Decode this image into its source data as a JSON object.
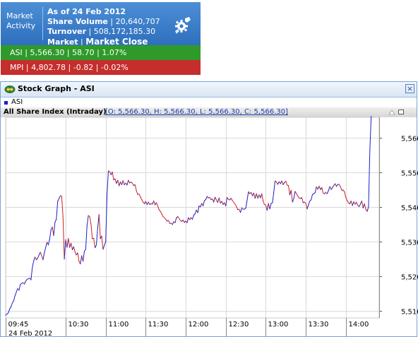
{
  "market": {
    "label": "Market Activity",
    "as_of": "As of 24 Feb 2012",
    "share_volume_label": "Share Volume",
    "share_volume": "20,640,707",
    "turnover_label": "Turnover",
    "turnover": "508,172,185.30",
    "market_label": "Market",
    "market_status": "Market Close",
    "icon": "gear-settings-icon",
    "asi_text": "ASI | 5,566.30 | 58.70 | 1.07%",
    "mpi_text": "MPI | 4,802.78 | -0.82 | -0.02%",
    "asi_color": "#2f9a2a",
    "mpi_color": "#c62d2d"
  },
  "window": {
    "title": "Stock Graph - ASI",
    "close_label": "×",
    "legend_label": "ASI",
    "legend_color": "#1e1ec8",
    "index_name": "All Share Index (Intraday)",
    "ohlc": "[O: 5,566.30,  H: 5,566.30,  L: 5,566.30,  C: 5,566.30]"
  },
  "chart_data": {
    "type": "line",
    "title": "All Share Index (Intraday)",
    "xlabel": "",
    "ylabel": "",
    "date_label": "24 Feb 2012",
    "x_ticks": [
      "09:45",
      "10:30",
      "11:00",
      "11:30",
      "12:00",
      "12:30",
      "13:00",
      "13:30",
      "14:00"
    ],
    "y_ticks": [
      "5,510",
      "5,520",
      "5,530",
      "5,540",
      "5,550",
      "5,560"
    ],
    "x_range_minutes": [
      585,
      865
    ],
    "ylim": [
      5508,
      5566
    ],
    "grid": true,
    "up_color": "#1e1ec8",
    "down_color": "#d21e1e",
    "series": [
      {
        "name": "ASI",
        "points": [
          [
            585,
            5508.8
          ],
          [
            587,
            5509.5
          ],
          [
            588,
            5510.6
          ],
          [
            589,
            5511.2
          ],
          [
            590,
            5512.3
          ],
          [
            591,
            5512.9
          ],
          [
            592,
            5514.4
          ],
          [
            594,
            5516.5
          ],
          [
            595,
            5516.0
          ],
          [
            596,
            5517.7
          ],
          [
            598,
            5518.2
          ],
          [
            599,
            5517.8
          ],
          [
            600,
            5518.6
          ],
          [
            601,
            5519.1
          ],
          [
            603,
            5519.5
          ],
          [
            604,
            5519.0
          ],
          [
            605,
            5522.6
          ],
          [
            606,
            5524.5
          ],
          [
            607,
            5525.6
          ],
          [
            608,
            5524.8
          ],
          [
            609,
            5525.3
          ],
          [
            611,
            5527.0
          ],
          [
            612,
            5526.0
          ],
          [
            613,
            5524.8
          ],
          [
            614,
            5526.8
          ],
          [
            616,
            5529.9
          ],
          [
            617,
            5529.1
          ],
          [
            618,
            5530.8
          ],
          [
            619,
            5533.4
          ],
          [
            620,
            5534.3
          ],
          [
            621,
            5531.8
          ],
          [
            622,
            5535.7
          ],
          [
            623,
            5536.5
          ],
          [
            624,
            5541.7
          ],
          [
            626,
            5543.3
          ],
          [
            627,
            5543.2
          ],
          [
            628,
            5537.4
          ],
          [
            629,
            5525.0
          ],
          [
            630,
            5530.6
          ],
          [
            631,
            5528.4
          ],
          [
            632,
            5531.0
          ],
          [
            633,
            5528.4
          ],
          [
            634,
            5529.6
          ],
          [
            635,
            5527.7
          ],
          [
            636,
            5528.6
          ],
          [
            637,
            5527.1
          ],
          [
            638,
            5526.2
          ],
          [
            639,
            5526.8
          ],
          [
            640,
            5524.4
          ],
          [
            641,
            5523.6
          ],
          [
            642,
            5526.0
          ],
          [
            643,
            5524.4
          ],
          [
            644,
            5527.3
          ],
          [
            645,
            5527.8
          ],
          [
            646,
            5534.6
          ],
          [
            647,
            5537.6
          ],
          [
            648,
            5537.3
          ],
          [
            649,
            5535.1
          ],
          [
            650,
            5530.9
          ],
          [
            651,
            5531.0
          ],
          [
            652,
            5528.3
          ],
          [
            653,
            5529.1
          ],
          [
            654,
            5534.1
          ],
          [
            655,
            5537.9
          ],
          [
            656,
            5530.9
          ],
          [
            657,
            5531.7
          ],
          [
            658,
            5527.8
          ],
          [
            660,
            5530.1
          ],
          [
            661,
            5543.7
          ],
          [
            662,
            5550.5
          ],
          [
            663,
            5550.3
          ],
          [
            664,
            5549.4
          ],
          [
            665,
            5550.2
          ],
          [
            666,
            5547.9
          ],
          [
            667,
            5548.2
          ],
          [
            668,
            5546.9
          ],
          [
            669,
            5547.8
          ],
          [
            670,
            5546.2
          ],
          [
            671,
            5547.3
          ],
          [
            672,
            5546.5
          ],
          [
            673,
            5547.7
          ],
          [
            674,
            5546.5
          ],
          [
            675,
            5547.0
          ],
          [
            676,
            5546.4
          ],
          [
            677,
            5547.8
          ],
          [
            678,
            5547.0
          ],
          [
            679,
            5547.3
          ],
          [
            680,
            5546.9
          ],
          [
            681,
            5546.3
          ],
          [
            682,
            5546.5
          ],
          [
            683,
            5544.8
          ],
          [
            684,
            5543.7
          ],
          [
            685,
            5543.8
          ],
          [
            686,
            5543.0
          ],
          [
            687,
            5542.2
          ],
          [
            688,
            5541.5
          ],
          [
            689,
            5541.0
          ],
          [
            690,
            5541.7
          ],
          [
            691,
            5540.8
          ],
          [
            692,
            5541.5
          ],
          [
            693,
            5540.8
          ],
          [
            694,
            5541.0
          ],
          [
            695,
            5540.9
          ],
          [
            696,
            5541.8
          ],
          [
            697,
            5540.7
          ],
          [
            698,
            5541.3
          ],
          [
            699,
            5540.3
          ],
          [
            700,
            5539.3
          ],
          [
            701,
            5538.8
          ],
          [
            702,
            5538.1
          ],
          [
            703,
            5537.3
          ],
          [
            704,
            5537.0
          ],
          [
            705,
            5536.5
          ],
          [
            706,
            5536.0
          ],
          [
            707,
            5536.2
          ],
          [
            708,
            5535.3
          ],
          [
            709,
            5535.4
          ],
          [
            710,
            5535.0
          ],
          [
            711,
            5535.8
          ],
          [
            712,
            5535.5
          ],
          [
            713,
            5536.9
          ],
          [
            714,
            5537.3
          ],
          [
            715,
            5536.8
          ],
          [
            716,
            5536.1
          ],
          [
            717,
            5535.9
          ],
          [
            718,
            5536.3
          ],
          [
            719,
            5535.6
          ],
          [
            720,
            5536.0
          ],
          [
            721,
            5535.5
          ],
          [
            722,
            5537.0
          ],
          [
            723,
            5536.4
          ],
          [
            724,
            5537.0
          ],
          [
            725,
            5536.5
          ],
          [
            726,
            5537.7
          ],
          [
            727,
            5538.1
          ],
          [
            728,
            5539.2
          ],
          [
            729,
            5538.4
          ],
          [
            730,
            5540.4
          ],
          [
            731,
            5540.1
          ],
          [
            732,
            5541.1
          ],
          [
            733,
            5540.4
          ],
          [
            734,
            5541.9
          ],
          [
            735,
            5542.2
          ],
          [
            736,
            5543.1
          ],
          [
            737,
            5542.7
          ],
          [
            738,
            5542.8
          ],
          [
            739,
            5542.2
          ],
          [
            740,
            5542.4
          ],
          [
            741,
            5541.5
          ],
          [
            742,
            5542.9
          ],
          [
            743,
            5542.1
          ],
          [
            744,
            5541.4
          ],
          [
            745,
            5542.7
          ],
          [
            746,
            5541.2
          ],
          [
            747,
            5541.7
          ],
          [
            748,
            5540.8
          ],
          [
            749,
            5541.3
          ],
          [
            750,
            5540.4
          ],
          [
            751,
            5542.8
          ],
          [
            752,
            5542.3
          ],
          [
            753,
            5542.1
          ],
          [
            754,
            5542.6
          ],
          [
            755,
            5541.9
          ],
          [
            756,
            5541.4
          ],
          [
            757,
            5540.9
          ],
          [
            758,
            5540.2
          ],
          [
            759,
            5539.3
          ],
          [
            760,
            5539.4
          ],
          [
            761,
            5538.5
          ],
          [
            762,
            5539.8
          ],
          [
            763,
            5539.4
          ],
          [
            764,
            5539.5
          ],
          [
            765,
            5539.7
          ],
          [
            766,
            5542.1
          ],
          [
            767,
            5544.5
          ],
          [
            768,
            5543.9
          ],
          [
            769,
            5544.3
          ],
          [
            770,
            5543.3
          ],
          [
            771,
            5544.1
          ],
          [
            772,
            5542.6
          ],
          [
            773,
            5543.9
          ],
          [
            774,
            5542.6
          ],
          [
            775,
            5543.6
          ],
          [
            776,
            5542.7
          ],
          [
            777,
            5543.9
          ],
          [
            778,
            5541.8
          ],
          [
            779,
            5540.8
          ],
          [
            780,
            5540.6
          ],
          [
            781,
            5539.1
          ],
          [
            782,
            5541.1
          ],
          [
            783,
            5539.5
          ],
          [
            784,
            5541.1
          ],
          [
            785,
            5541.3
          ],
          [
            786,
            5544.3
          ],
          [
            787,
            5547.6
          ],
          [
            788,
            5547.3
          ],
          [
            789,
            5546.6
          ],
          [
            790,
            5547.4
          ],
          [
            791,
            5546.8
          ],
          [
            792,
            5547.6
          ],
          [
            793,
            5546.5
          ],
          [
            794,
            5547.2
          ],
          [
            795,
            5547.5
          ],
          [
            796,
            5546.4
          ],
          [
            797,
            5546.3
          ],
          [
            798,
            5543.6
          ],
          [
            799,
            5544.9
          ],
          [
            800,
            5541.5
          ],
          [
            801,
            5542.5
          ],
          [
            802,
            5544.6
          ],
          [
            803,
            5543.9
          ],
          [
            804,
            5543.2
          ],
          [
            805,
            5542.7
          ],
          [
            806,
            5542.5
          ],
          [
            807,
            5542.8
          ],
          [
            808,
            5541.3
          ],
          [
            809,
            5541.5
          ],
          [
            810,
            5541.1
          ],
          [
            811,
            5539.5
          ],
          [
            812,
            5540.7
          ],
          [
            813,
            5541.8
          ],
          [
            814,
            5542.1
          ],
          [
            815,
            5543.7
          ],
          [
            816,
            5543.9
          ],
          [
            817,
            5544.2
          ],
          [
            818,
            5545.9
          ],
          [
            819,
            5545.2
          ],
          [
            820,
            5546.1
          ],
          [
            821,
            5545.1
          ],
          [
            822,
            5545.7
          ],
          [
            823,
            5544.1
          ],
          [
            824,
            5543.9
          ],
          [
            825,
            5544.3
          ],
          [
            826,
            5543.9
          ],
          [
            827,
            5544.8
          ],
          [
            828,
            5546.0
          ],
          [
            829,
            5545.1
          ],
          [
            830,
            5545.7
          ],
          [
            831,
            5546.3
          ],
          [
            832,
            5546.8
          ],
          [
            833,
            5546.0
          ],
          [
            834,
            5546.6
          ],
          [
            835,
            5546.6
          ],
          [
            836,
            5545.9
          ],
          [
            837,
            5544.9
          ],
          [
            838,
            5545.0
          ],
          [
            839,
            5544.4
          ],
          [
            840,
            5542.8
          ],
          [
            841,
            5541.9
          ],
          [
            842,
            5541.2
          ],
          [
            843,
            5541.0
          ],
          [
            844,
            5541.8
          ],
          [
            845,
            5540.5
          ],
          [
            846,
            5541.6
          ],
          [
            847,
            5540.9
          ],
          [
            848,
            5541.4
          ],
          [
            849,
            5540.5
          ],
          [
            850,
            5540.2
          ],
          [
            851,
            5540.9
          ],
          [
            852,
            5541.8
          ],
          [
            853,
            5539.8
          ],
          [
            854,
            5541.0
          ],
          [
            855,
            5539.4
          ],
          [
            856,
            5538.8
          ],
          [
            857,
            5540.1
          ],
          [
            858,
            5556.3
          ],
          [
            859,
            5566.3
          ]
        ]
      }
    ]
  }
}
